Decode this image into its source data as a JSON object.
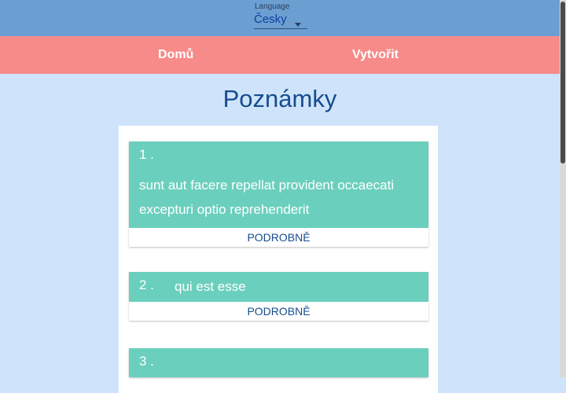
{
  "language": {
    "label": "Language",
    "selected": "Česky"
  },
  "nav": {
    "home": "Domů",
    "create": "Vytvořit"
  },
  "page": {
    "title": "Poznámky"
  },
  "notes": [
    {
      "number": "1 .",
      "title": "sunt aut facere repellat provident occaecati excepturi optio reprehenderit",
      "detail_label": "PODROBNĚ"
    },
    {
      "number": "2 .",
      "title": "qui est esse",
      "detail_label": "PODROBNĚ"
    },
    {
      "number": "3 .",
      "title": "",
      "detail_label": ""
    }
  ],
  "colors": {
    "topbar": "#6b9fd2",
    "navbar": "#f68b89",
    "background": "#cfe4fb",
    "card_header": "#6bcfbd",
    "title": "#154d8f"
  }
}
